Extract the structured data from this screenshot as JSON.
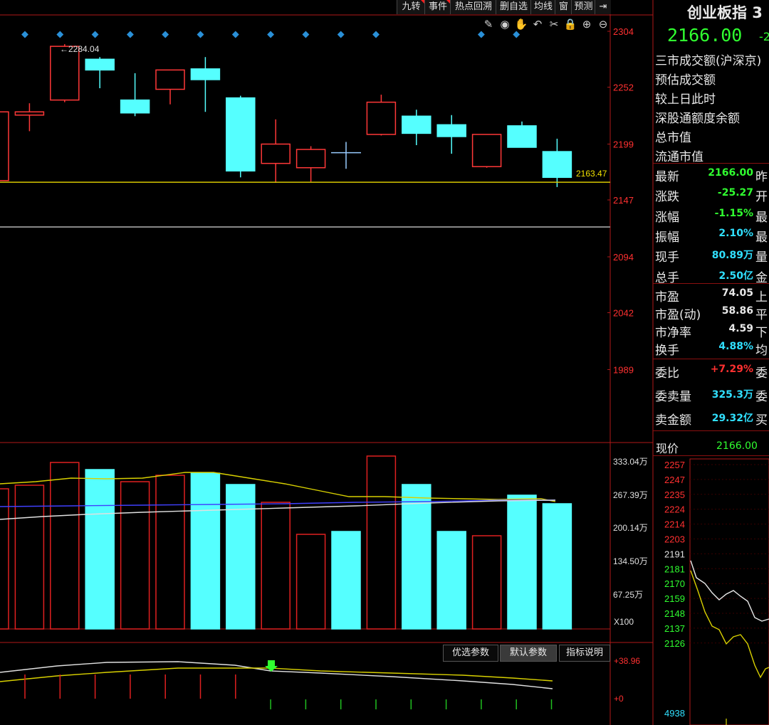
{
  "toolbar": {
    "buttons": [
      "九转",
      "事件",
      "热点回溯",
      "删自选",
      "均线",
      "窗",
      "预测"
    ],
    "exit_icon": "exit-icon"
  },
  "tool_icons": [
    "pen-icon",
    "eye-icon",
    "hand-icon",
    "undo-icon",
    "scissors-icon",
    "lock-icon",
    "zoom-in-icon",
    "zoom-out-icon"
  ],
  "main_axis": {
    "labels": [
      "2304",
      "2252",
      "2199",
      "2147",
      "2094",
      "2042",
      "1989"
    ],
    "color": "#ff3030"
  },
  "markers": {
    "high_label": "2284.04",
    "current_label": "2163.47"
  },
  "candles": [
    {
      "o": 2165,
      "c": 2229,
      "h": 2232,
      "l": 2163
    },
    {
      "o": 2226,
      "c": 2229,
      "h": 2237,
      "l": 2211
    },
    {
      "o": 2240,
      "c": 2290,
      "h": 2292,
      "l": 2238
    },
    {
      "o": 2278,
      "c": 2268,
      "h": 2280,
      "l": 2251
    },
    {
      "o": 2240,
      "c": 2228,
      "h": 2265,
      "l": 2225
    },
    {
      "o": 2250,
      "c": 2268,
      "h": 2268,
      "l": 2236
    },
    {
      "o": 2269,
      "c": 2259,
      "h": 2280,
      "l": 2229
    },
    {
      "o": 2242,
      "c": 2174,
      "h": 2244,
      "l": 2168
    },
    {
      "o": 2181,
      "c": 2199,
      "h": 2222,
      "l": 2163
    },
    {
      "o": 2177,
      "c": 2194,
      "h": 2197,
      "l": 2164
    },
    {
      "o": 2191,
      "c": 2191,
      "h": 2201,
      "l": 2176
    },
    {
      "o": 2208,
      "c": 2238,
      "h": 2245,
      "l": 2207
    },
    {
      "o": 2225,
      "c": 2209,
      "h": 2231,
      "l": 2198
    },
    {
      "o": 2217,
      "c": 2206,
      "h": 2226,
      "l": 2190
    },
    {
      "o": 2178,
      "c": 2208,
      "h": 2208,
      "l": 2177
    },
    {
      "o": 2216,
      "c": 2196,
      "h": 2220,
      "l": 2196
    },
    {
      "o": 2192,
      "c": 2168,
      "h": 2204,
      "l": 2159
    }
  ],
  "volume_axis": {
    "labels": [
      "333.04万",
      "267.39万",
      "200.14万",
      "134.50万",
      "67.25万"
    ],
    "unit": "X100"
  },
  "volumes": [
    {
      "v": 197,
      "up": true
    },
    {
      "v": 202,
      "up": true
    },
    {
      "v": 234,
      "up": true
    },
    {
      "v": 224,
      "up": false
    },
    {
      "v": 207,
      "up": true
    },
    {
      "v": 216,
      "up": true
    },
    {
      "v": 219,
      "up": false
    },
    {
      "v": 203,
      "up": false
    },
    {
      "v": 178,
      "up": true
    },
    {
      "v": 133,
      "up": true
    },
    {
      "v": 137,
      "up": false
    },
    {
      "v": 243,
      "up": true
    },
    {
      "v": 203,
      "up": false
    },
    {
      "v": 137,
      "up": false
    },
    {
      "v": 131,
      "up": true
    },
    {
      "v": 188,
      "up": false
    },
    {
      "v": 176,
      "up": false
    }
  ],
  "sub_buttons": [
    "优选参数",
    "默认参数",
    "指标说明"
  ],
  "sub_axis": [
    "+38.96",
    "+0"
  ],
  "panel": {
    "title": "创业板指 3",
    "price": "2166.00",
    "price_extra": "-2",
    "info_labels": [
      "三市成交额(沪深京)",
      "预估成交额",
      "较上日此时",
      "深股通额度余额",
      "总市值",
      "流通市值"
    ],
    "quote_rows": [
      {
        "label": "最新",
        "value": "2166.00",
        "color": "#30ff30",
        "tail": "昨"
      },
      {
        "label": "涨跌",
        "value": "-25.27",
        "color": "#30ff30",
        "tail": "开"
      },
      {
        "label": "涨幅",
        "value": "-1.15%",
        "color": "#30ff30",
        "tail": "最"
      },
      {
        "label": "振幅",
        "value": "2.10%",
        "color": "#30e0ff",
        "tail": "最"
      },
      {
        "label": "现手",
        "value": "80.89万",
        "color": "#30e0ff",
        "tail": "量"
      },
      {
        "label": "总手",
        "value": "2.50亿",
        "color": "#30e0ff",
        "tail": "金"
      }
    ],
    "pe_rows": [
      {
        "label": "市盈",
        "value": "74.05",
        "color": "#e8e8e8",
        "tail": "上"
      },
      {
        "label": "市盈(动)",
        "value": "58.86",
        "color": "#e8e8e8",
        "tail": "平"
      },
      {
        "label": "市净率",
        "value": "4.59",
        "color": "#e8e8e8",
        "tail": "下"
      },
      {
        "label": "换手",
        "value": "4.88%",
        "color": "#30e0ff",
        "tail": "均"
      }
    ],
    "order_rows": [
      {
        "label": "委比",
        "value": "+7.29%",
        "color": "#ff3030",
        "tail": "委"
      },
      {
        "label": "委卖量",
        "value": "325.3万",
        "color": "#30e0ff",
        "tail": "委"
      },
      {
        "label": "卖金额",
        "value": "29.32亿",
        "color": "#30e0ff",
        "tail": "买"
      }
    ],
    "current_label": "现价",
    "current_value": "2166.00",
    "mini_axis": [
      "2257",
      "2247",
      "2235",
      "2224",
      "2214",
      "2203",
      "2191",
      "2181",
      "2170",
      "2159",
      "2148",
      "2137",
      "2126"
    ],
    "mini_vol_label": "4938"
  }
}
